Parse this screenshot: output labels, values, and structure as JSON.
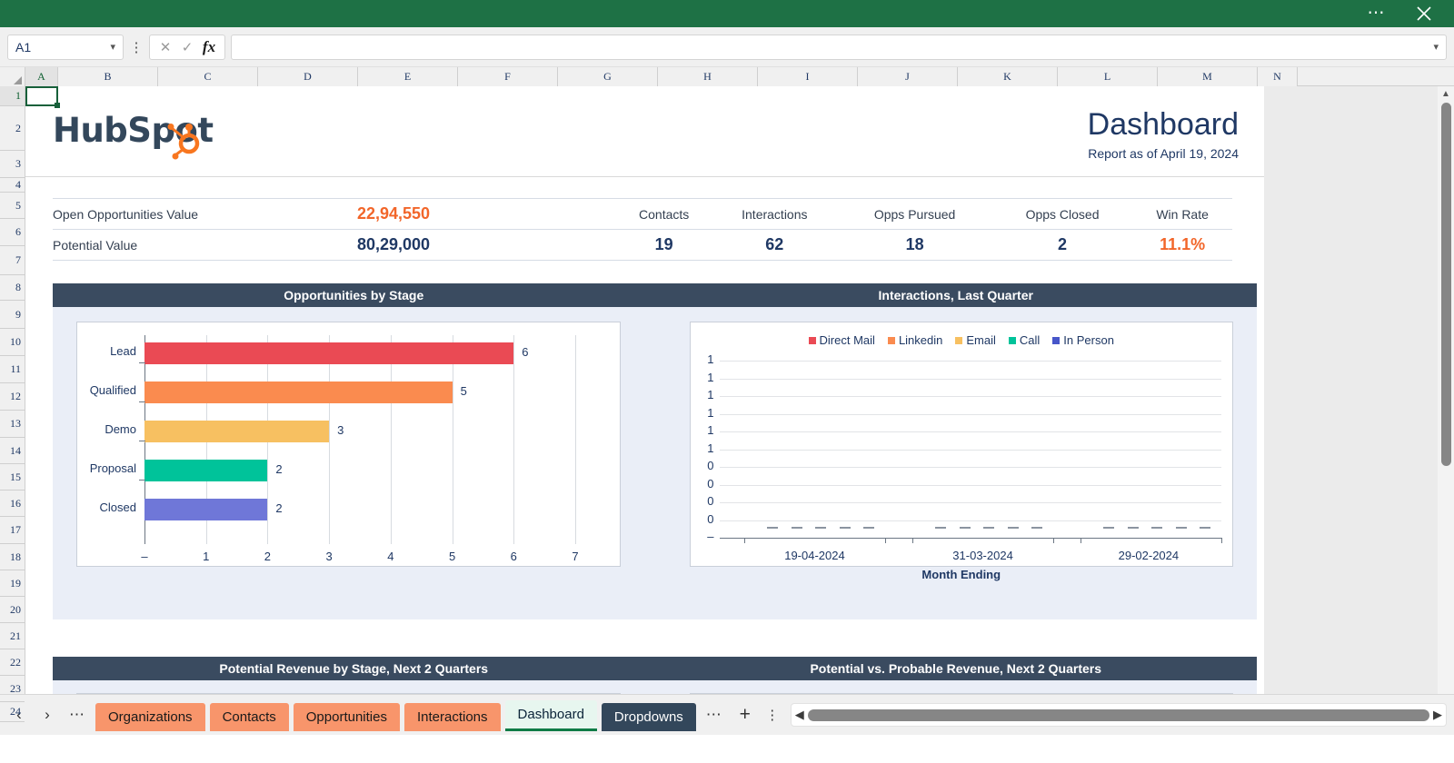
{
  "window": {
    "more_options_icon": "ellipsis-horizontal-icon",
    "close_icon": "close-icon",
    "accent_green": "#1e7145"
  },
  "formula_bar": {
    "name_box_value": "A1",
    "name_box_chevron": "chevron-down-icon",
    "cancel_icon": "cancel-icon",
    "confirm_icon": "check-icon",
    "fx_label": "fx",
    "input_value": "",
    "expand_chevron": "chevron-down-icon"
  },
  "grid": {
    "columns": [
      "A",
      "B",
      "C",
      "D",
      "E",
      "F",
      "G",
      "H",
      "I",
      "J",
      "K",
      "L",
      "M",
      "N"
    ],
    "selected_column": "A",
    "rows": [
      1,
      2,
      3,
      4,
      5,
      6,
      7,
      8,
      9,
      10,
      11,
      12,
      13,
      14,
      15,
      16,
      17,
      18,
      19,
      20,
      21,
      22,
      23,
      24
    ],
    "selected_row": 1,
    "active_cell": "A1"
  },
  "report": {
    "brand": {
      "name": "HubSpot",
      "logo_icon": "hubspot-sprocket-icon",
      "wordmark_color": "#33475b",
      "sprocket_color": "#f8761f"
    },
    "title": "Dashboard",
    "subtitle": "Report as of April 19, 2024",
    "kpi": {
      "left_rows": [
        {
          "label": "Open Opportunities Value",
          "value": "22,94,550",
          "color": "#f2662a"
        },
        {
          "label": "Potential Value",
          "value": "80,29,000",
          "color": "#1f3864"
        }
      ],
      "headers": [
        "Contacts",
        "Interactions",
        "Opps Pursued",
        "Opps Closed",
        "Win Rate"
      ],
      "values": [
        "19",
        "62",
        "18",
        "2",
        "11.1%"
      ],
      "win_rate_color": "#f2662a"
    },
    "panels": [
      {
        "left_title": "Opportunities by Stage",
        "right_title": "Interactions, Last Quarter"
      },
      {
        "left_title": "Potential Revenue by Stage, Next 2 Quarters",
        "right_title": "Potential vs. Probable Revenue, Next 2 Quarters"
      }
    ]
  },
  "chart_data": [
    {
      "type": "bar",
      "orientation": "horizontal",
      "title": "Opportunities by Stage",
      "categories": [
        "Lead",
        "Qualified",
        "Demo",
        "Proposal",
        "Closed"
      ],
      "values": [
        6,
        5,
        3,
        2,
        2
      ],
      "data_labels": [
        "6",
        "5",
        "3",
        "2",
        "2"
      ],
      "colors": [
        "#ea4a54",
        "#fa8b4f",
        "#f7c061",
        "#00c39a",
        "#6f77d8"
      ],
      "xlabel": "",
      "ylabel": "",
      "xlim": [
        0,
        7
      ],
      "xticks": [
        "–",
        "1",
        "2",
        "3",
        "4",
        "5",
        "6",
        "7"
      ],
      "grid": true,
      "legend": "none"
    },
    {
      "type": "bar",
      "orientation": "vertical",
      "title": "Interactions, Last Quarter",
      "xlabel": "Month Ending",
      "ylabel": "",
      "xticks": [
        "19-04-2024",
        "31-03-2024",
        "29-02-2024"
      ],
      "yticks": [
        "1",
        "1",
        "1",
        "1",
        "1",
        "1",
        "0",
        "0",
        "0",
        "0",
        "–"
      ],
      "grid": true,
      "legend": "top",
      "series": [
        {
          "name": "Direct Mail",
          "color": "#ea4a54",
          "values": [
            0,
            0,
            0,
            0,
            0,
            0,
            0,
            0,
            0,
            0,
            0,
            0,
            0,
            0,
            0
          ]
        },
        {
          "name": "Linkedin",
          "color": "#fa8b4f",
          "values": [
            0,
            0,
            0,
            0,
            0,
            0,
            0,
            0,
            0,
            0,
            0,
            0,
            0,
            0,
            0
          ]
        },
        {
          "name": "Email",
          "color": "#f7c061",
          "values": [
            0,
            0,
            0,
            0,
            0,
            0,
            0,
            0,
            0,
            0,
            0,
            0,
            0,
            0,
            0
          ]
        },
        {
          "name": "Call",
          "color": "#00c39a",
          "values": [
            0,
            0,
            0,
            0,
            0,
            0,
            0,
            0,
            0,
            0,
            0,
            0,
            0,
            0,
            0
          ]
        },
        {
          "name": "In Person",
          "color": "#4756c9",
          "values": [
            0,
            0,
            0,
            0,
            0,
            0,
            0,
            0,
            0,
            0,
            0,
            0,
            0,
            0,
            0
          ]
        }
      ],
      "data_labels_all_zero": "–"
    }
  ],
  "sheet_tabs": {
    "prev_icon": "chevron-left-icon",
    "next_icon": "chevron-right-icon",
    "overflow_left_icon": "ellipsis-horizontal-icon",
    "overflow_right_icon": "ellipsis-horizontal-icon",
    "add_icon": "plus-icon",
    "menu_icon": "ellipsis-vertical-icon",
    "tabs": [
      {
        "label": "Organizations",
        "style": "orange",
        "active": false
      },
      {
        "label": "Contacts",
        "style": "orange",
        "active": false
      },
      {
        "label": "Opportunities",
        "style": "orange",
        "active": false
      },
      {
        "label": "Interactions",
        "style": "orange",
        "active": false
      },
      {
        "label": "Dashboard",
        "style": "active",
        "active": true
      },
      {
        "label": "Dropdowns",
        "style": "dark",
        "active": false
      }
    ],
    "hscroll_left_icon": "triangle-left-icon",
    "hscroll_right_icon": "triangle-right-icon"
  },
  "vertical_scrollbar": {
    "up_icon": "triangle-up-icon",
    "down_icon": "triangle-down-icon"
  }
}
